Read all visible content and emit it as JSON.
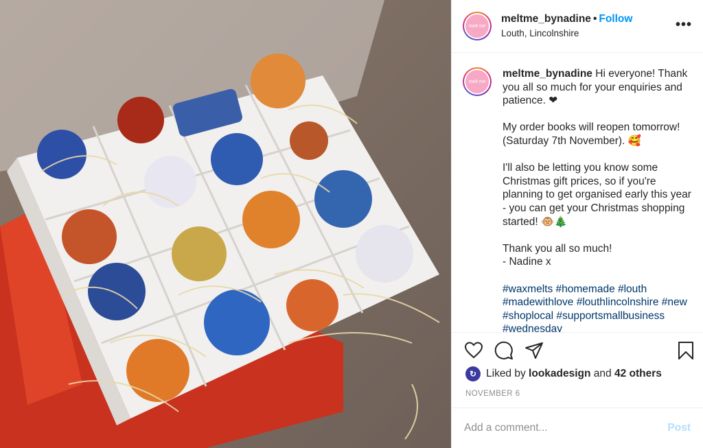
{
  "header": {
    "username": "meltme_bynadine",
    "separator": "•",
    "follow_label": "Follow",
    "location": "Louth, Lincolnshire",
    "more_icon": "more-horizontal-icon",
    "avatar_text": "melt me"
  },
  "caption": {
    "username": "meltme_bynadine",
    "text": " Hi everyone! Thank you all so much for your enquiries and patience. ❤\n\nMy order books will reopen tomorrow! (Saturday 7th November). 🥰\n\nI'll also be letting you know some Christmas gift prices, so if you're planning to get organised early this year - you can get your Christmas shopping started! 🐵🎄\n\nThank you all so much!\n- Nadine x\n\n",
    "hashtags": "#waxmelts #homemade #louth #madewithlove #louthlincolnshire #new #shoplocal #supportsmallbusiness #wednesday"
  },
  "actions": {
    "like_icon": "heart-icon",
    "comment_icon": "comment-icon",
    "share_icon": "paper-plane-icon",
    "save_icon": "bookmark-icon"
  },
  "likes": {
    "prefix": "Liked by",
    "user": "lookadesign",
    "conjunction": "and",
    "others": "42 others"
  },
  "date": "NOVEMBER 6",
  "comment": {
    "placeholder": "Add a comment...",
    "post_label": "Post"
  },
  "colors": {
    "follow": "#0095f6",
    "hashtag": "#00376b",
    "muted": "#8e8e8e",
    "post_disabled": "#b2dffc"
  }
}
